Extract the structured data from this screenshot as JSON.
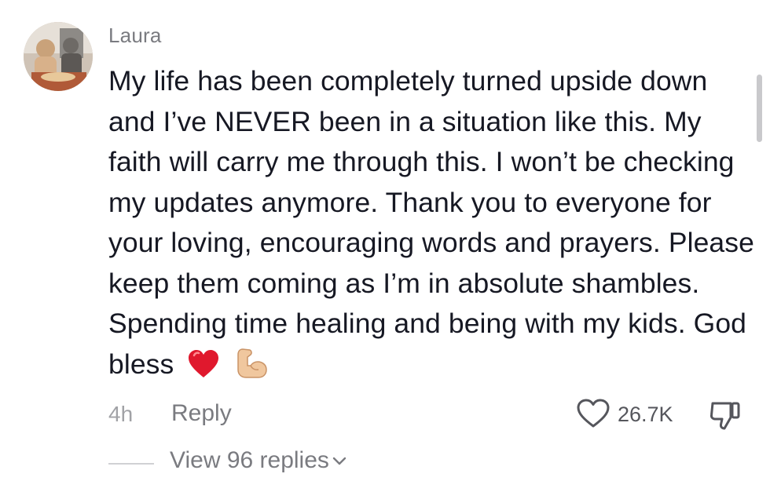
{
  "comment": {
    "username": "Laura",
    "text": "My life has been completely turned upside down and I’ve NEVER been in a situation like this. My faith will carry me through this. I won’t be checking my updates anymore. Thank you to everyone for your loving, encouraging words and prayers. Please keep them coming as I’m in absolute shambles. Spending time healing and being with my kids. God bless",
    "emojis": [
      "red-heart-icon",
      "flexed-biceps-icon"
    ],
    "time": "4h",
    "reply_label": "Reply",
    "like_count": "26.7K",
    "view_replies_label": "View 96 replies"
  },
  "colors": {
    "text_primary": "#161823",
    "text_secondary": "#7a7b80",
    "text_muted": "#a1a2a6",
    "heart_emoji": "#e0182d"
  }
}
